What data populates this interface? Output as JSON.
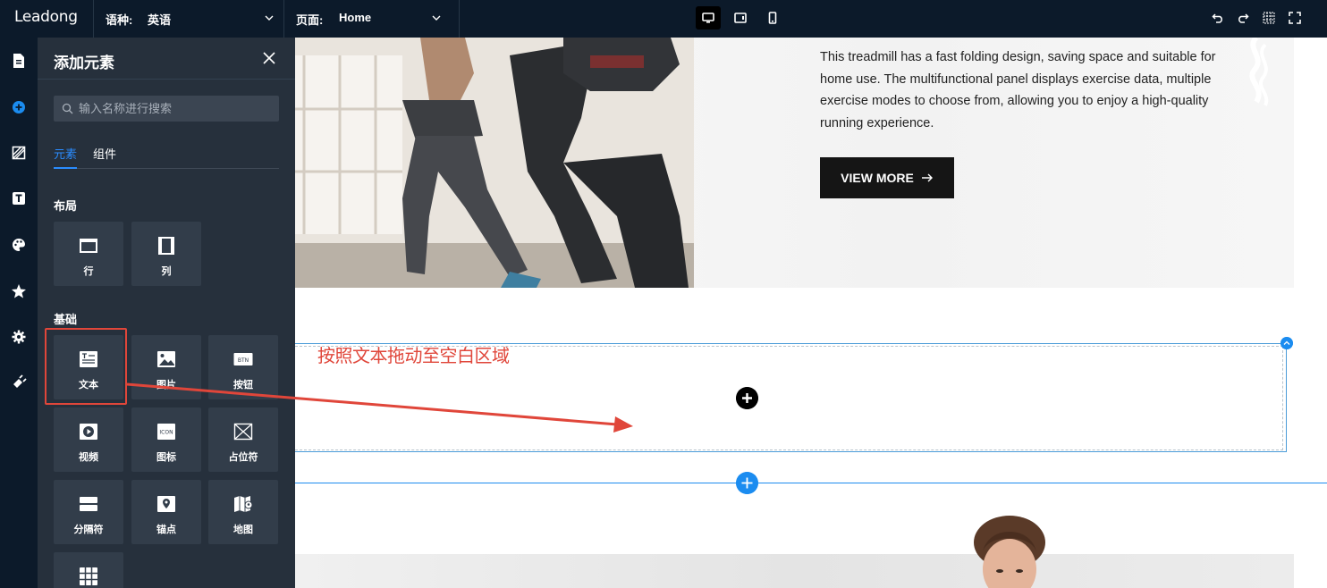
{
  "app": {
    "logo": "Leadong"
  },
  "topbar": {
    "language_label": "语种:",
    "language_value": "英语",
    "page_label": "页面:",
    "page_value": "Home",
    "devices": [
      "desktop-icon",
      "tablet-icon",
      "mobile-icon"
    ],
    "active_device": "desktop",
    "right_icons": [
      "undo-icon",
      "redo-icon",
      "grid-icon",
      "fullscreen-icon"
    ]
  },
  "rail": {
    "icons": [
      "page-icon",
      "add-element-icon",
      "background-icon",
      "text-style-icon",
      "palette-icon",
      "star-icon",
      "settings-icon",
      "plugin-icon"
    ]
  },
  "panel": {
    "title": "添加元素",
    "search_placeholder": "输入名称进行搜索",
    "tabs": [
      "元素",
      "组件"
    ],
    "active_tab": "元素",
    "sections": {
      "layout": {
        "title": "布局",
        "items": [
          "行",
          "列"
        ]
      },
      "basic": {
        "title": "基础",
        "items": [
          "文本",
          "图片",
          "按钮",
          "视频",
          "图标",
          "占位符",
          "分隔符",
          "锚点",
          "地图",
          ""
        ]
      }
    },
    "highlighted_item": "文本"
  },
  "canvas": {
    "hero_text": "This treadmill has a fast folding design, saving space and suitable for home use. The multifunctional panel displays exercise data, multiple exercise modes to choose from, allowing you to enjoy a high-quality running experience.",
    "button_label": "VIEW MORE",
    "annotation": "按照文本拖动至空白区域"
  },
  "colors": {
    "topbar_bg": "#0c1a2a",
    "panel_bg": "#26303c",
    "tile_bg": "#323d4a",
    "accent": "#2a8cff",
    "highlight": "#e0463a"
  }
}
